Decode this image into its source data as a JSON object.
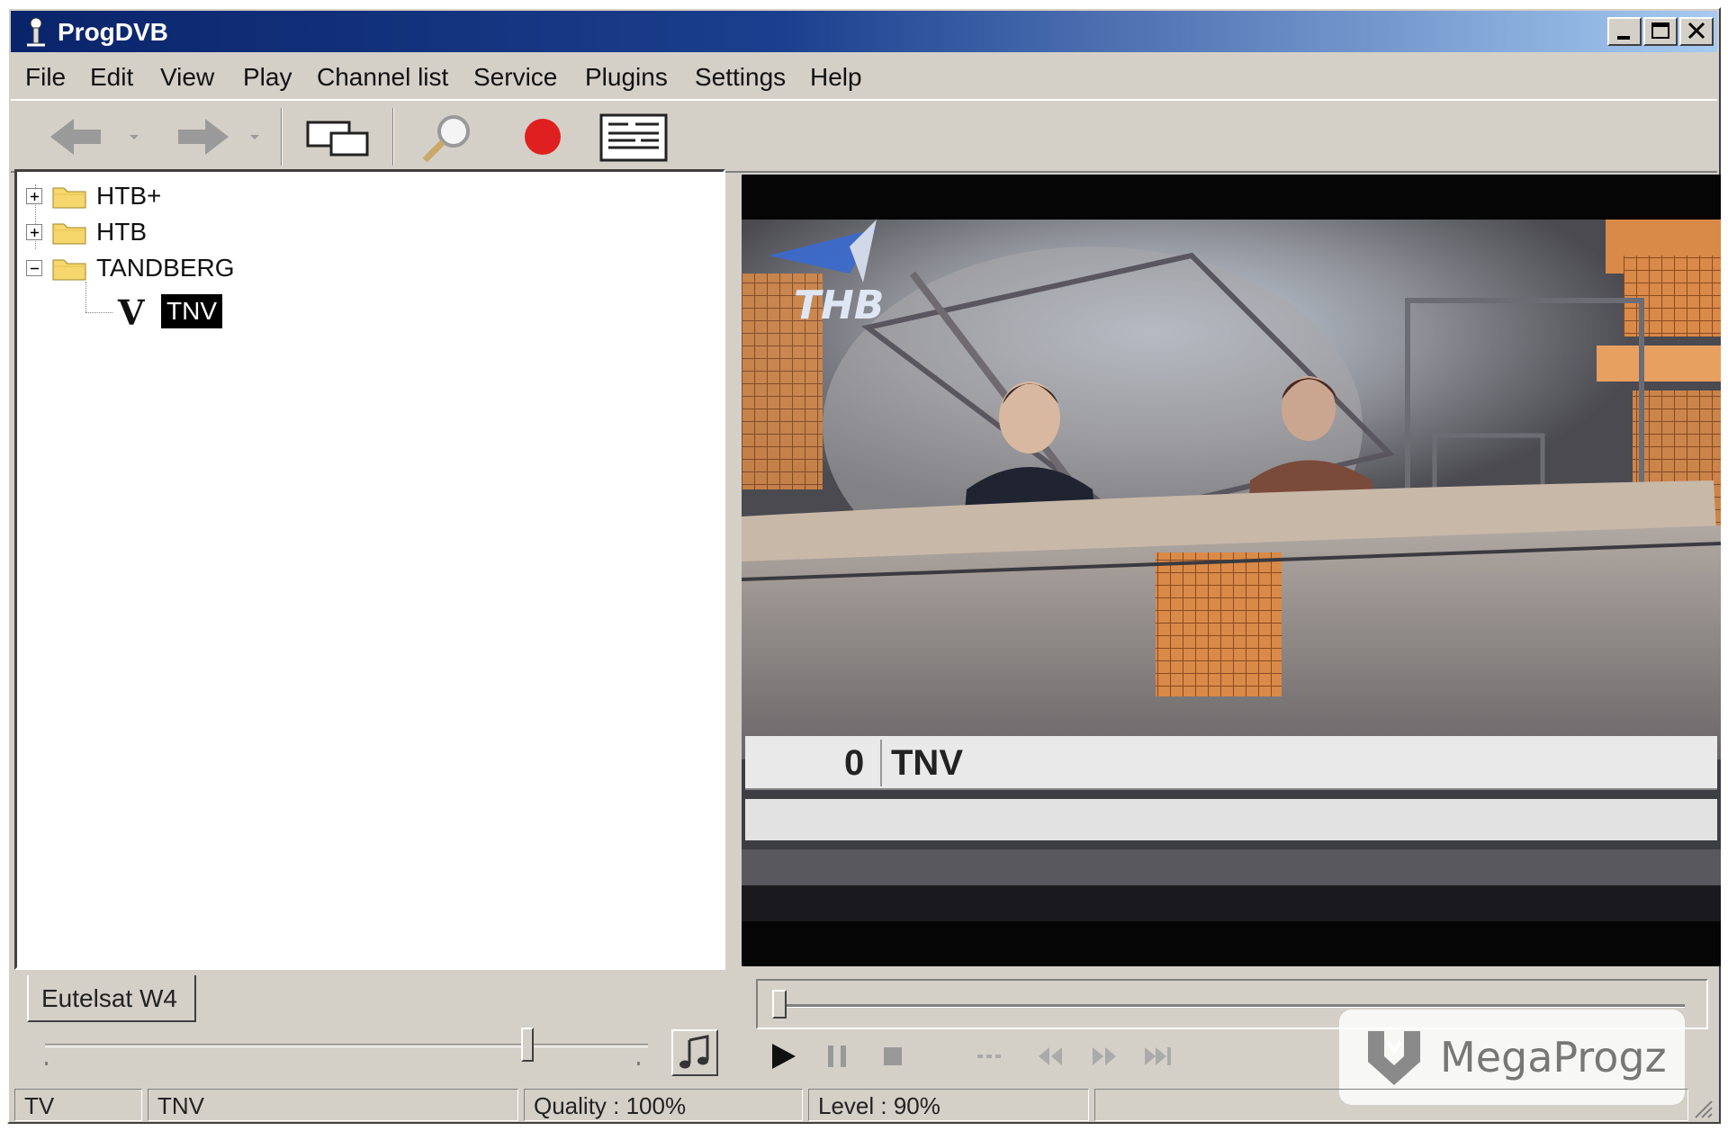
{
  "window": {
    "title": "ProgDVB"
  },
  "menu": [
    "File",
    "Edit",
    "View",
    "Play",
    "Channel list",
    "Service",
    "Plugins",
    "Settings",
    "Help"
  ],
  "tree": {
    "items": [
      {
        "label": "НТВ+",
        "expanded": false
      },
      {
        "label": "НТВ",
        "expanded": false
      },
      {
        "label": "TANDBERG",
        "expanded": true
      }
    ],
    "selected_channel": "TNV",
    "channel_icon_text": "V"
  },
  "satellite_tab": "Eutelsat W4",
  "volume": {
    "level": 0.8
  },
  "seek": {
    "position": 0.0
  },
  "video": {
    "logo_text": "ТНВ",
    "osd_number": "0",
    "osd_channel": "TNV"
  },
  "watermark": {
    "text": "MegaProgz"
  },
  "status": {
    "mode": "TV",
    "channel": "TNV",
    "quality": "Quality : 100%",
    "level": "Level : 90%",
    "extra": ""
  },
  "colors": {
    "title_bar_start": "#0a246a",
    "title_bar_end": "#a6caf0",
    "window_face": "#d4d0c8",
    "record": "#e02020"
  },
  "icons": [
    "back-arrow-icon",
    "forward-arrow-icon",
    "windows-icon",
    "search-icon",
    "record-icon",
    "epg-icon",
    "music-note-icon"
  ]
}
